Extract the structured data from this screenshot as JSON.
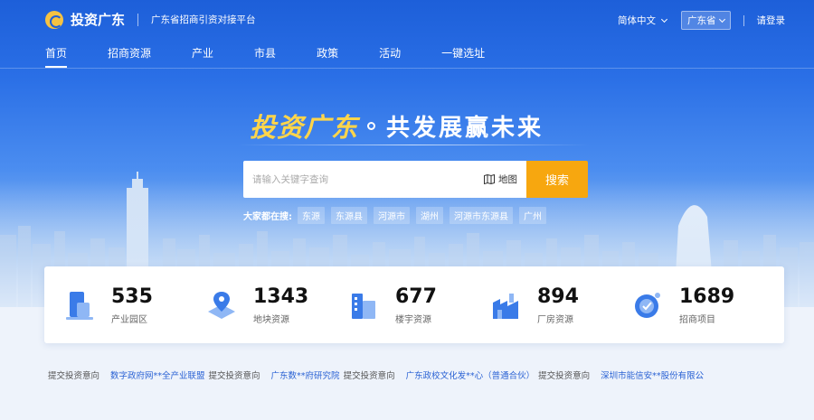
{
  "header": {
    "logo_text": "投资广东",
    "slogan": "广东省招商引资对接平台",
    "language": "简体中文",
    "region": "广东省",
    "login": "请登录"
  },
  "nav": {
    "items": [
      {
        "label": "首页",
        "active": true
      },
      {
        "label": "招商资源"
      },
      {
        "label": "产业"
      },
      {
        "label": "市县"
      },
      {
        "label": "政策"
      },
      {
        "label": "活动"
      },
      {
        "label": "一键选址"
      }
    ]
  },
  "hero": {
    "headline_main": "投资广东",
    "headline_sub": "共发展赢未来"
  },
  "search": {
    "placeholder": "请输入关键字查询",
    "map_label": "地图",
    "button_label": "搜索"
  },
  "hot": {
    "label": "大家都在搜:",
    "tags": [
      "东源",
      "东源县",
      "河源市",
      "湖州",
      "河源市东源县",
      "广州"
    ]
  },
  "stats": [
    {
      "value": "535",
      "label": "产业园区",
      "icon": "industrial-park-icon"
    },
    {
      "value": "1343",
      "label": "地块资源",
      "icon": "land-resource-icon"
    },
    {
      "value": "677",
      "label": "楼宇资源",
      "icon": "building-resource-icon"
    },
    {
      "value": "894",
      "label": "厂房资源",
      "icon": "factory-resource-icon"
    },
    {
      "value": "1689",
      "label": "招商项目",
      "icon": "investment-project-icon"
    }
  ],
  "ticker": {
    "items": [
      {
        "company": "",
        "action": "提交投资意向"
      },
      {
        "company": "数字政府网**全产业联盟",
        "action": "提交投资意向"
      },
      {
        "company": "广东数**府研究院",
        "action": "提交投资意向"
      },
      {
        "company": "广东政校文化发**心（普通合伙）",
        "action": "提交投资意向"
      },
      {
        "company": "深圳市能信安**股份有限公",
        "action": ""
      }
    ]
  },
  "colors": {
    "brand_blue": "#1d5fd9",
    "accent_yellow": "#ffd54a",
    "search_orange": "#f7a70f",
    "icon_blue": "#3a7be8"
  }
}
